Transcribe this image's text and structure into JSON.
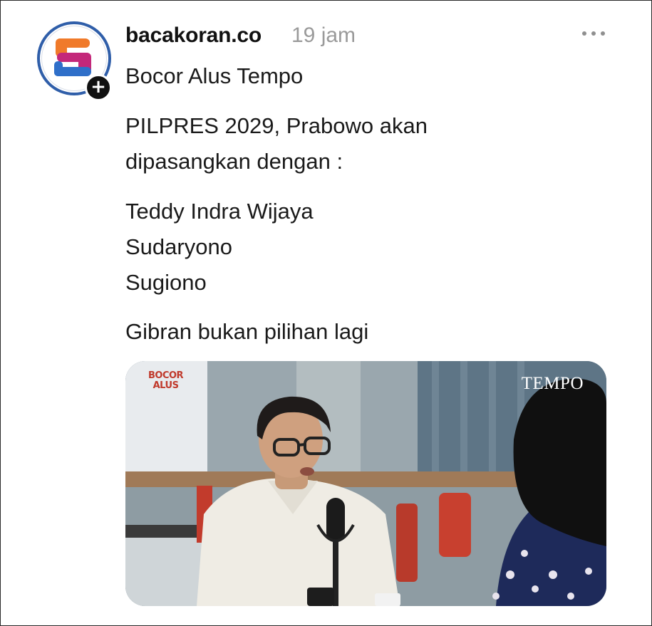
{
  "post": {
    "username": "bacakoran.co",
    "timestamp": "19 jam",
    "follow_icon": "+",
    "lines": [
      "Bocor Alus Tempo",
      "PILPRES 2029, Prabowo akan",
      "dipasangkan dengan :",
      "Teddy Indra Wijaya",
      "Sudaryono",
      "Sugiono",
      "Gibran bukan pilihan lagi"
    ]
  },
  "media": {
    "logo_left_line1": "BOCOR",
    "logo_left_line2": "ALUS",
    "logo_right": "TEMPO"
  },
  "icons": {
    "avatar": "bacakoran-logo-icon",
    "follow": "plus-icon",
    "more": "more-dots-icon"
  },
  "colors": {
    "username": "#111111",
    "timestamp": "#9a9a9a",
    "logo_blue": "#2f5ea9",
    "logo_orange": "#f07a2a",
    "logo_magenta": "#c4287a"
  }
}
